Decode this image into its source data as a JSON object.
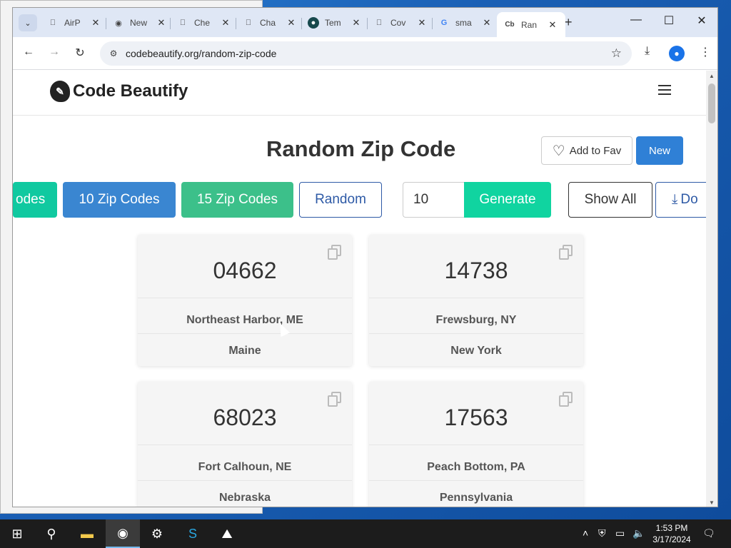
{
  "browser": {
    "tabs": [
      {
        "title": "AirP",
        "icon": "apple-icon"
      },
      {
        "title": "New",
        "icon": "chrome-icon"
      },
      {
        "title": "Che",
        "icon": "apple-icon"
      },
      {
        "title": "Cha",
        "icon": "apple-icon"
      },
      {
        "title": "Tem",
        "icon": "globe-icon"
      },
      {
        "title": "Cov",
        "icon": "apple-icon"
      },
      {
        "title": "sma",
        "icon": "google-icon"
      },
      {
        "title": "Ran",
        "icon": "codebeautify-icon",
        "active": true
      }
    ],
    "active_tab_favicon_text": "Cb",
    "url": "codebeautify.org/random-zip-code"
  },
  "site": {
    "logo_text": "Code Beautify",
    "page_title": "Random Zip Code",
    "add_to_fav_label": "Add to Fav",
    "new_label": "New"
  },
  "controls": {
    "codes_label": "odes",
    "ten_label": "10 Zip Codes",
    "fifteen_label": "15 Zip Codes",
    "random_label": "Random",
    "count_value": "10",
    "generate_label": "Generate",
    "show_all_label": "Show All",
    "download_label": "Do"
  },
  "cards": [
    {
      "zip": "04662",
      "city": "Northeast Harbor, ME",
      "state": "Maine"
    },
    {
      "zip": "14738",
      "city": "Frewsburg, NY",
      "state": "New York"
    },
    {
      "zip": "68023",
      "city": "Fort Calhoun, NE",
      "state": "Nebraska"
    },
    {
      "zip": "17563",
      "city": "Peach Bottom, PA",
      "state": "Pennsylvania"
    }
  ],
  "taskbar": {
    "time": "1:53 PM",
    "date": "3/17/2024"
  },
  "colors": {
    "new_button": "#2f80d6",
    "ten_button": "#3a86d1",
    "fifteen_button": "#3cc08a",
    "generate_button": "#10d4a0",
    "taskbar": "#1c1c1c"
  }
}
